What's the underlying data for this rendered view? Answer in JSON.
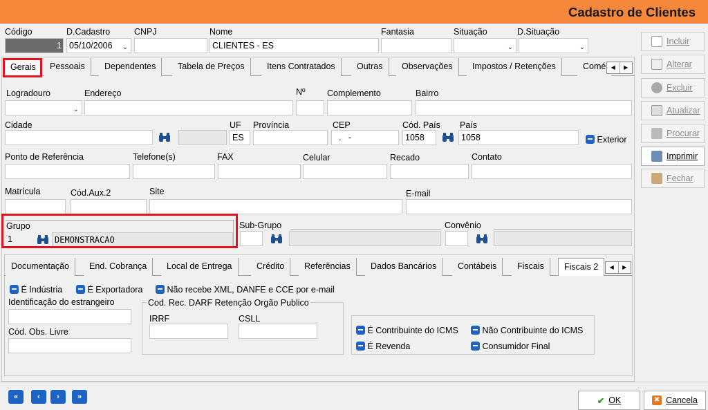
{
  "window": {
    "title": "Cadastro de Clientes"
  },
  "header": {
    "labels": {
      "codigo": "Código",
      "dcadastro": "D.Cadastro",
      "cnpj": "CNPJ",
      "nome": "Nome",
      "fantasia": "Fantasia",
      "situacao": "Situação",
      "dsituacao": "D.Situação"
    },
    "values": {
      "codigo": "1",
      "dcadastro": "05/10/2006",
      "cnpj": "",
      "nome": "CLIENTES - ES",
      "fantasia": ""
    }
  },
  "main_tabs": [
    "Gerais",
    "Pessoais",
    "Dependentes",
    "Tabela de Preços",
    "Itens Contratados",
    "Outras",
    "Observações",
    "Impostos / Retenções",
    "Comé"
  ],
  "fields": {
    "logradouro": "Logradouro",
    "endereco": "Endereço",
    "numero": "Nº",
    "complemento": "Complemento",
    "bairro": "Bairro",
    "cidade": "Cidade",
    "uf": "UF",
    "uf_value": "ES",
    "provincia": "Província",
    "cep": "CEP",
    "cep_value": "  .   -",
    "cod_pais": "Cód. País",
    "cod_pais_value": "1058",
    "pais": "País",
    "pais_value": "1058",
    "exterior": "Exterior",
    "ponto_ref": "Ponto de Referência",
    "telefone": "Telefone(s)",
    "fax": "FAX",
    "celular": "Celular",
    "recado": "Recado",
    "contato": "Contato",
    "matricula": "Matrícula",
    "cod_aux2": "Cód.Aux.2",
    "site": "Site",
    "email": "E-mail",
    "grupo": "Grupo",
    "grupo_code": "1",
    "grupo_name": "DEMONSTRACAO",
    "sub_grupo": "Sub-Grupo",
    "convenio": "Convênio"
  },
  "sub_tabs": [
    "Documentação",
    "End. Cobrança",
    "Local de Entrega",
    "Crédito",
    "Referências",
    "Dados Bancários",
    "Contábeis",
    "Fiscais",
    "Fiscais 2"
  ],
  "fiscais2": {
    "chk_industria": "É Indústria",
    "chk_exportadora": "É Exportadora",
    "chk_nao_recebe": "Não recebe XML, DANFE e CCE por e-mail",
    "ident_estrangeiro": "Identificação do estrangeiro",
    "cod_obs_livre": "Cód. Obs. Livre",
    "darf_title": "Cod. Rec. DARF Retenção Orgão Publico",
    "irrf": "IRRF",
    "csll": "CSLL",
    "contribuinte_icms": "É Contribuinte do ICMS",
    "nao_contribuinte_icms": "Não Contribuinte do ICMS",
    "revenda": "É Revenda",
    "consumidor_final": "Consumidor Final"
  },
  "side_buttons": [
    {
      "label": "Incluir",
      "enabled": false,
      "icon": "page-icon"
    },
    {
      "label": "Alterar",
      "enabled": false,
      "icon": "pencil-icon"
    },
    {
      "label": "Excluir",
      "enabled": false,
      "icon": "eraser-icon"
    },
    {
      "label": "Atualizar",
      "enabled": false,
      "icon": "refresh-icon"
    },
    {
      "label": "Procurar",
      "enabled": false,
      "icon": "binoculars-icon"
    },
    {
      "label": "Imprimir",
      "enabled": true,
      "icon": "printer-icon"
    },
    {
      "label": "Fechar",
      "enabled": false,
      "icon": "folder-close-icon"
    }
  ],
  "footer": {
    "ok": "OK",
    "cancel": "Cancela"
  },
  "colors": {
    "title_bg": "#f5883a",
    "accent_blue": "#1d63c4",
    "highlight_red": "#e0141e"
  }
}
